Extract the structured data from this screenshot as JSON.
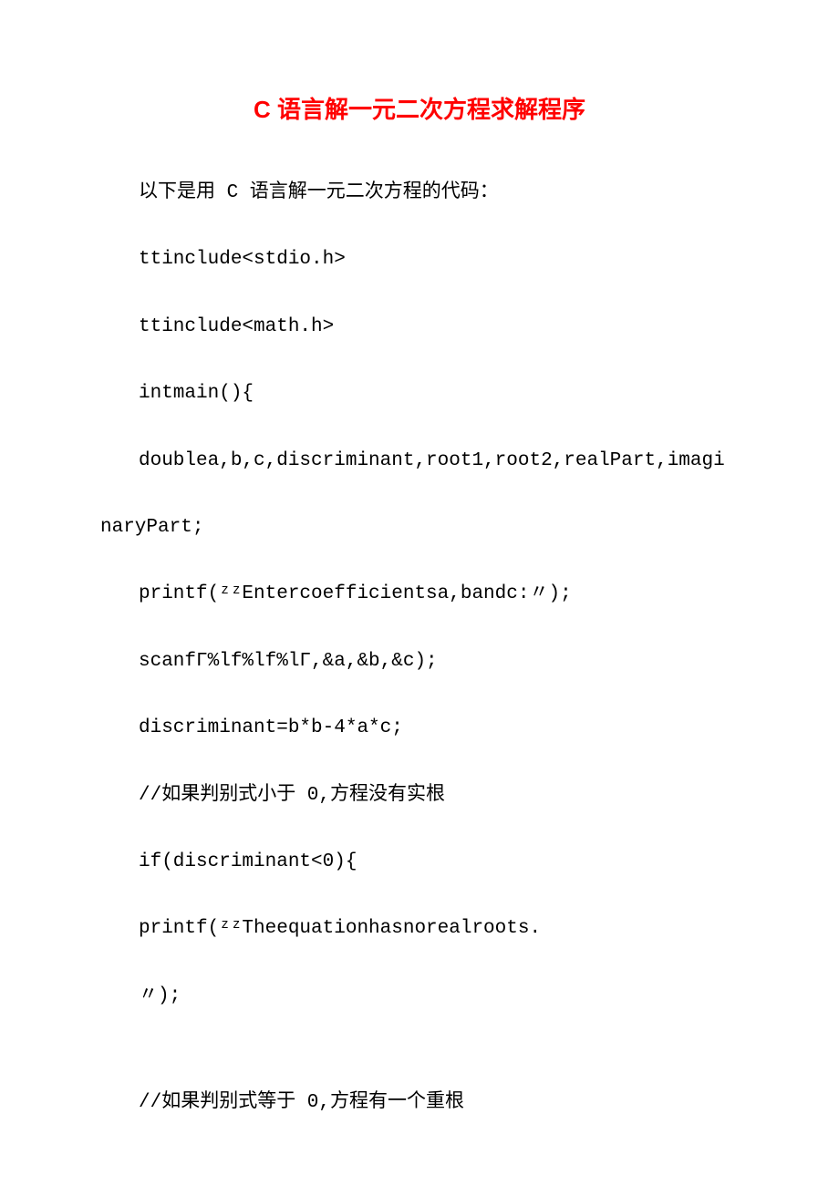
{
  "title": "C 语言解一元二次方程求解程序",
  "lines": [
    "以下是用 C 语言解一元二次方程的代码：",
    "ttinclude<stdio.h>",
    "ttinclude<math.h>",
    "intmain(){",
    "doublea,b,c,discriminant,root1,root2,realPart,imagi",
    "naryPart;",
    "printf(ᶻᶻEntercoefficientsa,bandc:〃);",
    "scanfΓ%lf%lf%lΓ,&a,&b,&c);",
    "discriminant=b*b-4*a*c;",
    "//如果判别式小于 0,方程没有实根",
    "if(discriminant<0){",
    "printf(ᶻᶻTheequationhasnorealroots.",
    "〃);",
    "//如果判别式等于 0,方程有一个重根"
  ]
}
